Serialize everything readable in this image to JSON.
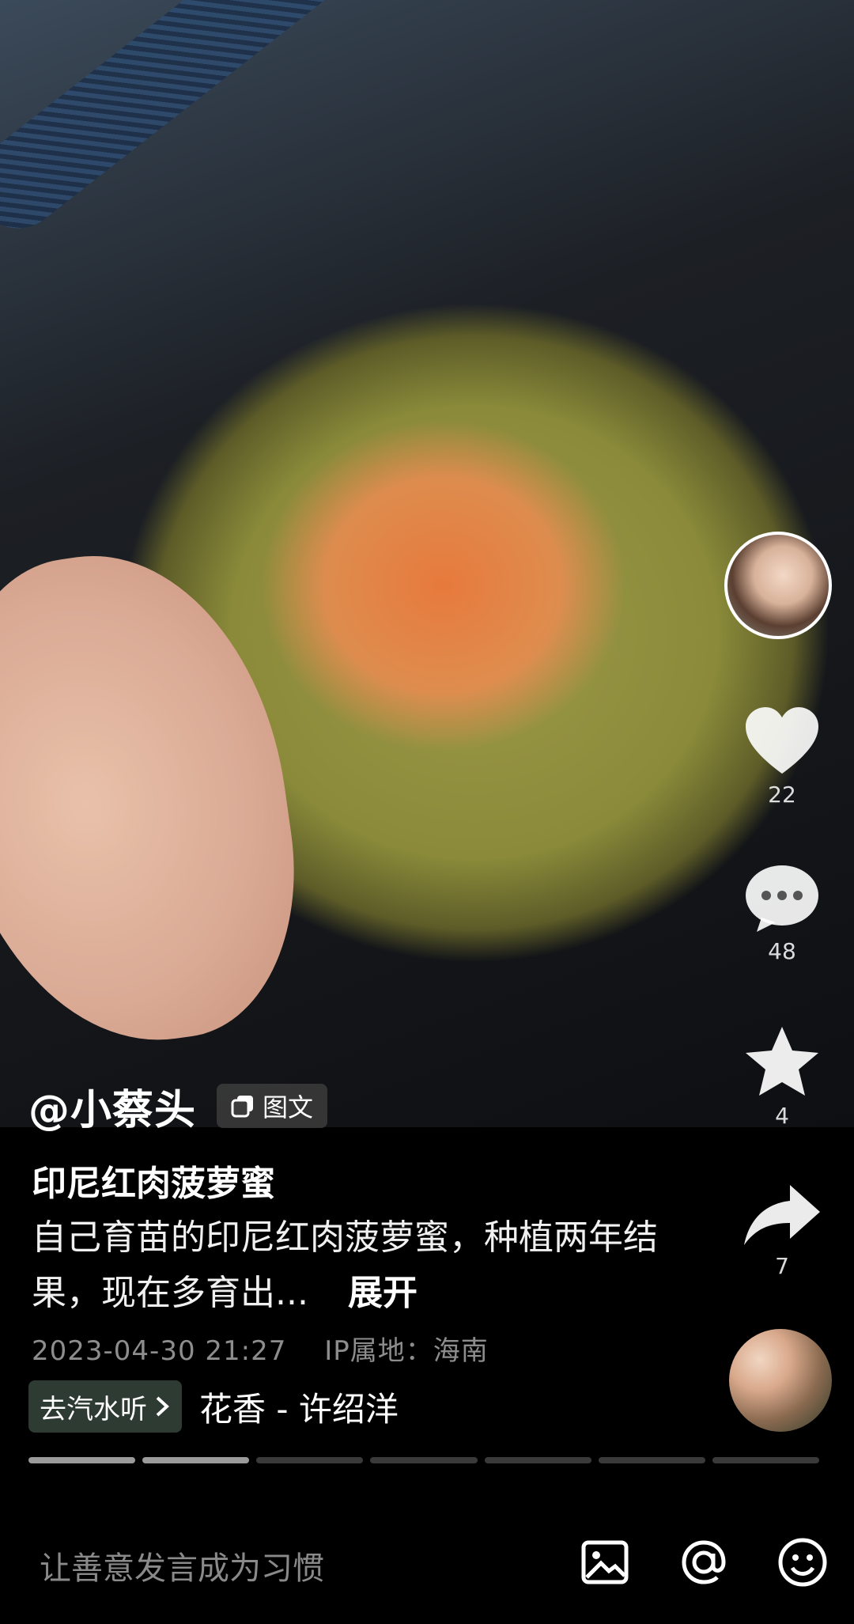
{
  "post": {
    "author": "@小蔡头",
    "type_tag": "图文",
    "title": "印尼红肉菠萝蜜",
    "description": "自己育苗的印尼红肉菠萝蜜，种植两年结果，现在多育出...",
    "expand_label": "展开",
    "date": "2023-04-30  21:27",
    "ip_location": "IP属地：海南"
  },
  "actions": {
    "likes": "22",
    "comments": "48",
    "favorites": "4",
    "shares": "7"
  },
  "music": {
    "button_label": "去汽水听",
    "song": "花香 - 许绍洋"
  },
  "progress": {
    "total_pages": 7,
    "current_page": 2
  },
  "composer": {
    "placeholder": "让善意发言成为习惯"
  },
  "icons": [
    "heart-icon",
    "comment-icon",
    "star-icon",
    "share-icon",
    "image-icon",
    "at-icon",
    "emoji-icon",
    "chevron-right-icon",
    "gallery-icon"
  ]
}
